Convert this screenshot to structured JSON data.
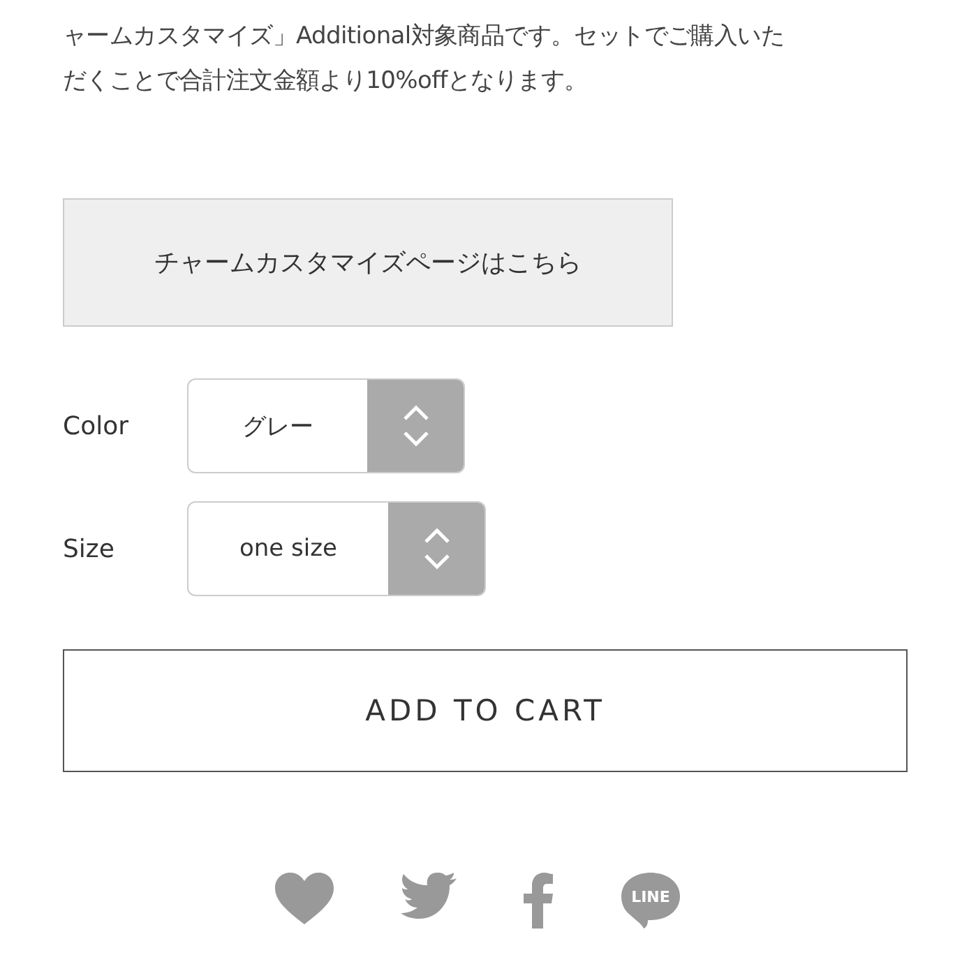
{
  "description": {
    "lines": [
      "ャームカスタマイズ」Additional対象商品です。セットでご購入いた",
      "だくことで合計注文金額より10%offとなります。"
    ]
  },
  "customize_link": "チャームカスタマイズページはこちら",
  "options": [
    {
      "label": "Color",
      "value": "グレー"
    },
    {
      "label": "Size",
      "value": "one size"
    }
  ],
  "add_to_cart": "ADD TO CART",
  "share": {
    "line_label": "LINE"
  }
}
